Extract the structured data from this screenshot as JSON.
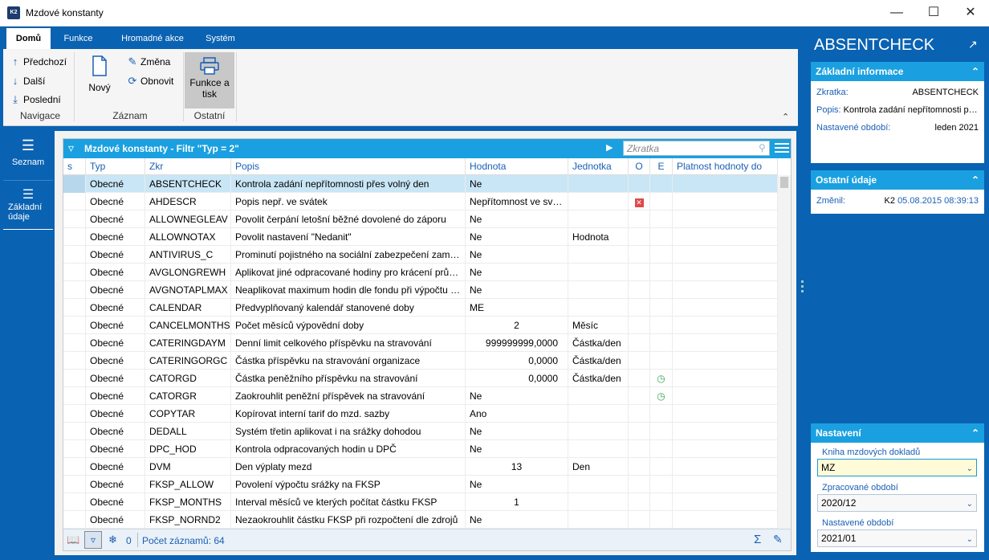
{
  "window": {
    "title": "Mzdové konstanty",
    "logo": "K2"
  },
  "ribbon": {
    "tabs": [
      "Domů",
      "Funkce",
      "Hromadné akce",
      "Systém"
    ],
    "navigace": {
      "prev": "Předchozí",
      "next": "Další",
      "last": "Poslední",
      "group": "Navigace"
    },
    "zaznam": {
      "new": "Nový",
      "edit": "Změna",
      "refresh": "Obnovit",
      "group": "Záznam"
    },
    "ostatni": {
      "print_line1": "Funkce a",
      "print_line2": "tisk",
      "group": "Ostatní"
    }
  },
  "leftnav": {
    "list": "Seznam",
    "basic_line1": "Základní",
    "basic_line2": "údaje"
  },
  "grid": {
    "title": "Mzdové konstanty - Filtr \"Typ = 2\"",
    "search_placeholder": "Zkratka",
    "columns": [
      "s",
      "Typ",
      "Zkr",
      "Popis",
      "Hodnota",
      "Jednotka",
      "O",
      "E",
      "Platnost hodnoty do"
    ],
    "rows": [
      {
        "typ": "Obecné",
        "zkr": "ABSENTCHECK",
        "popis": "Kontrola zadání nepřítomnosti přes volný den",
        "hodnota": "Ne",
        "jednotka": "",
        "o": "",
        "e": ""
      },
      {
        "typ": "Obecné",
        "zkr": "AHDESCR",
        "popis": "Popis nepř. ve svátek",
        "hodnota": "Nepřítomnost ve svátek",
        "jednotka": "",
        "o": "red",
        "e": ""
      },
      {
        "typ": "Obecné",
        "zkr": "ALLOWNEGLEAV",
        "popis": "Povolit čerpání letošní běžné dovolené do záporu",
        "hodnota": "Ne",
        "jednotka": "",
        "o": "",
        "e": ""
      },
      {
        "typ": "Obecné",
        "zkr": "ALLOWNOTAX",
        "popis": "Povolit nastavení \"Nedanit\"",
        "hodnota": "Ne",
        "jednotka": "Hodnota",
        "o": "",
        "e": ""
      },
      {
        "typ": "Obecné",
        "zkr": "ANTIVIRUS_C",
        "popis": "Prominutí pojistného na sociální zabezpečení zaměstnavatele",
        "hodnota": "Ne",
        "jednotka": "",
        "o": "",
        "e": ""
      },
      {
        "typ": "Obecné",
        "zkr": "AVGLONGREWH",
        "popis": "Aplikovat jiné odpracované hodiny pro krácení průměru",
        "hodnota": "Ne",
        "jednotka": "",
        "o": "",
        "e": ""
      },
      {
        "typ": "Obecné",
        "zkr": "AVGNOTAPLMAX",
        "popis": "Neaplikovat maximum hodin dle fondu při výpočtu průměru",
        "hodnota": "Ne",
        "jednotka": "",
        "o": "",
        "e": ""
      },
      {
        "typ": "Obecné",
        "zkr": "CALENDAR",
        "popis": "Předvyplňovaný kalendář stanovené doby",
        "hodnota": "ME",
        "jednotka": "",
        "o": "",
        "e": ""
      },
      {
        "typ": "Obecné",
        "zkr": "CANCELMONTHS",
        "popis": "Počet měsíců výpovědní doby",
        "hodnota": "2",
        "jednotka": "Měsíc",
        "o": "",
        "e": "",
        "align": "center"
      },
      {
        "typ": "Obecné",
        "zkr": "CATERINGDAYM",
        "popis": "Denní limit celkového příspěvku na stravování",
        "hodnota": "999999999,0000",
        "jednotka": "Částka/den",
        "o": "",
        "e": "",
        "align": "right"
      },
      {
        "typ": "Obecné",
        "zkr": "CATERINGORGC",
        "popis": "Částka příspěvku na stravování organizace",
        "hodnota": "0,0000",
        "jednotka": "Částka/den",
        "o": "",
        "e": "",
        "align": "right"
      },
      {
        "typ": "Obecné",
        "zkr": "CATORGD",
        "popis": "Částka peněžního příspěvku na stravování",
        "hodnota": "0,0000",
        "jednotka": "Částka/den",
        "o": "",
        "e": "green",
        "align": "right"
      },
      {
        "typ": "Obecné",
        "zkr": "CATORGR",
        "popis": "Zaokrouhlit peněžní příspěvek na stravování",
        "hodnota": "Ne",
        "jednotka": "",
        "o": "",
        "e": "green"
      },
      {
        "typ": "Obecné",
        "zkr": "COPYTAR",
        "popis": "Kopírovat interní tarif do mzd. sazby",
        "hodnota": "Ano",
        "jednotka": "",
        "o": "",
        "e": ""
      },
      {
        "typ": "Obecné",
        "zkr": "DEDALL",
        "popis": "Systém třetin aplikovat i na srážky dohodou",
        "hodnota": "Ne",
        "jednotka": "",
        "o": "",
        "e": ""
      },
      {
        "typ": "Obecné",
        "zkr": "DPC_HOD",
        "popis": "Kontrola odpracovaných hodin u DPČ",
        "hodnota": "Ne",
        "jednotka": "",
        "o": "",
        "e": ""
      },
      {
        "typ": "Obecné",
        "zkr": "DVM",
        "popis": "Den výplaty mezd",
        "hodnota": "13",
        "jednotka": "Den",
        "o": "",
        "e": "",
        "align": "center"
      },
      {
        "typ": "Obecné",
        "zkr": "FKSP_ALLOW",
        "popis": "Povolení výpočtu srážky na FKSP",
        "hodnota": "Ne",
        "jednotka": "",
        "o": "",
        "e": ""
      },
      {
        "typ": "Obecné",
        "zkr": "FKSP_MONTHS",
        "popis": "Interval měsíců ve kterých počítat částku FKSP",
        "hodnota": "1",
        "jednotka": "",
        "o": "",
        "e": "",
        "align": "center"
      },
      {
        "typ": "Obecné",
        "zkr": "FKSP_NORND2",
        "popis": "Nezaokrouhlit částku FKSP při rozpočtení dle zdrojů",
        "hodnota": "Ne",
        "jednotka": "",
        "o": "",
        "e": ""
      }
    ],
    "footer": {
      "count_label": "Počet záznamů: 64",
      "frozen": "0"
    }
  },
  "right": {
    "title": "ABSENTCHECK",
    "basic": {
      "header": "Základní informace",
      "zkratka_label": "Zkratka:",
      "zkratka": "ABSENTCHECK",
      "popis_label": "Popis:",
      "popis": "Kontrola zadání nepřítomnosti přes volný den",
      "obdobi_label": "Nastavené období:",
      "obdobi": "leden 2021"
    },
    "other": {
      "header": "Ostatní údaje",
      "zmenil_label": "Změnil:",
      "zmenil_user": "K2",
      "zmenil_date": "05.08.2015 08:39:13"
    },
    "settings": {
      "header": "Nastavení",
      "kniha_label": "Kniha mzdových dokladů",
      "kniha": "MZ",
      "zprac_label": "Zpracované období",
      "zprac": "2020/12",
      "nast_label": "Nastavené období",
      "nast": "2021/01"
    }
  },
  "colors": {
    "blue": "#0a62b2",
    "header": "#1aa0e0",
    "selected_row": "#c9e6f6"
  }
}
